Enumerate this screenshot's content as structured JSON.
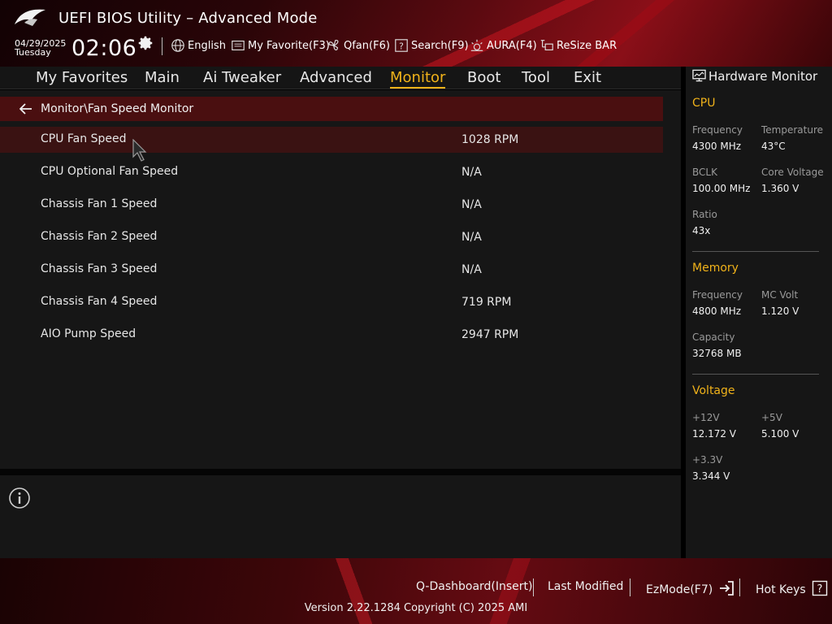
{
  "header": {
    "title": "UEFI BIOS Utility – Advanced Mode",
    "date": "04/29/2025",
    "day": "Tuesday",
    "time": "02:06",
    "toolbar": [
      {
        "label": "English",
        "icon": "globe-icon"
      },
      {
        "label": "My Favorite(F3)",
        "icon": "favorite-icon"
      },
      {
        "label": "Qfan(F6)",
        "icon": "fan-icon"
      },
      {
        "label": "Search(F9)",
        "icon": "help-search-icon"
      },
      {
        "label": "AURA(F4)",
        "icon": "aura-icon"
      },
      {
        "label": "ReSize BAR",
        "icon": "resize-bar-icon"
      }
    ]
  },
  "nav": {
    "tabs": [
      {
        "label": "My Favorites"
      },
      {
        "label": "Main"
      },
      {
        "label": "Ai Tweaker"
      },
      {
        "label": "Advanced"
      },
      {
        "label": "Monitor"
      },
      {
        "label": "Boot"
      },
      {
        "label": "Tool"
      },
      {
        "label": "Exit"
      }
    ],
    "active": "Monitor"
  },
  "main": {
    "breadcrumb": "Monitor\\Fan Speed Monitor",
    "rows": [
      {
        "label": "CPU Fan Speed",
        "value": "1028 RPM"
      },
      {
        "label": "CPU Optional Fan Speed",
        "value": "N/A"
      },
      {
        "label": "Chassis Fan 1 Speed",
        "value": "N/A"
      },
      {
        "label": "Chassis Fan 2 Speed",
        "value": "N/A"
      },
      {
        "label": "Chassis Fan 3 Speed",
        "value": "N/A"
      },
      {
        "label": "Chassis Fan 4 Speed",
        "value": "719 RPM"
      },
      {
        "label": "AIO Pump Speed",
        "value": "2947 RPM"
      }
    ]
  },
  "hardware_monitor": {
    "title": "Hardware Monitor",
    "cpu": {
      "heading": "CPU",
      "frequency_label": "Frequency",
      "frequency": "4300 MHz",
      "temperature_label": "Temperature",
      "temperature": "43°C",
      "bclk_label": "BCLK",
      "bclk": "100.00 MHz",
      "core_voltage_label": "Core Voltage",
      "core_voltage": "1.360 V",
      "ratio_label": "Ratio",
      "ratio": "43x"
    },
    "memory": {
      "heading": "Memory",
      "frequency_label": "Frequency",
      "frequency": "4800 MHz",
      "mc_volt_label": "MC Volt",
      "mc_volt": "1.120 V",
      "capacity_label": "Capacity",
      "capacity": "32768 MB"
    },
    "voltage": {
      "heading": "Voltage",
      "v12_label": "+12V",
      "v12": "12.172 V",
      "v5_label": "+5V",
      "v5": "5.100 V",
      "v33_label": "+3.3V",
      "v33": "3.344 V"
    }
  },
  "footer": {
    "qdashboard": "Q-Dashboard(Insert)",
    "last_modified": "Last Modified",
    "ezmode": "EzMode(F7)",
    "hotkeys": "Hot Keys",
    "version": "Version 2.22.1284 Copyright (C) 2025 AMI"
  },
  "colors": {
    "accent": "#f0b21a",
    "selection": "#3a1212",
    "breadcrumb": "#4a0f10"
  }
}
